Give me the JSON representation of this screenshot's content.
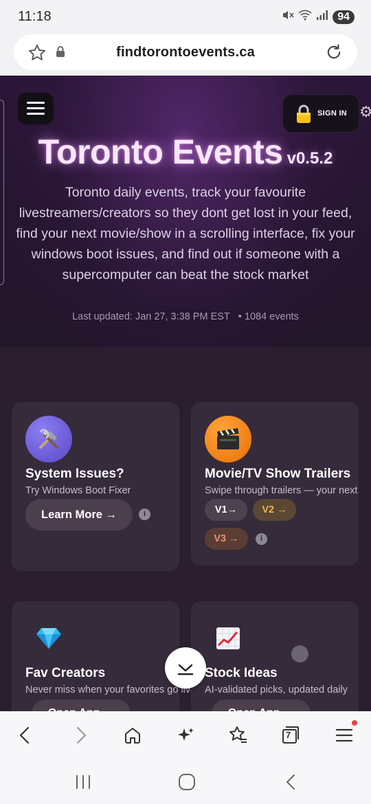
{
  "status_bar": {
    "time": "11:18",
    "battery": "94"
  },
  "browser": {
    "url": "findtorontoevents.ca",
    "tab_count": "7"
  },
  "page": {
    "title": "Toronto Events",
    "version": "v0.5.2",
    "subtitle": "Toronto daily events, track your favourite livestreamers/creators so they dont get lost in your feed, find your next movie/show in a scrolling interface, fix your windows boot issues, and find out if someone with a supercomputer can beat the stock market",
    "last_updated": "Last updated: Jan 27, 3:38 PM EST",
    "event_count": "• 1084 events",
    "sign_in_label": "SIGN IN",
    "cards": [
      {
        "title": "System Issues?",
        "desc": "Try Windows Boot Fixer",
        "button": "Learn More →",
        "icon": "tools-icon"
      },
      {
        "title": "Movie/TV Show Trailers",
        "desc": "Swipe through trailers — your next",
        "pills": [
          "V1→",
          "V2 →",
          "V3 →"
        ],
        "icon": "clapper-icon"
      },
      {
        "title": "Fav Creators",
        "desc": "Never miss when your favorites go live",
        "button": "Open App →",
        "icon": "gem-icon"
      },
      {
        "title": "Stock Ideas",
        "desc": "AI-validated picks, updated daily",
        "button": "Open App →",
        "icon": "chart-up-icon"
      }
    ]
  },
  "colors": {
    "accent_orange": "#f0830f",
    "accent_purple": "#6b5bd6",
    "pill_v2": "#e8a94a",
    "pill_v3": "#e58a6a"
  }
}
